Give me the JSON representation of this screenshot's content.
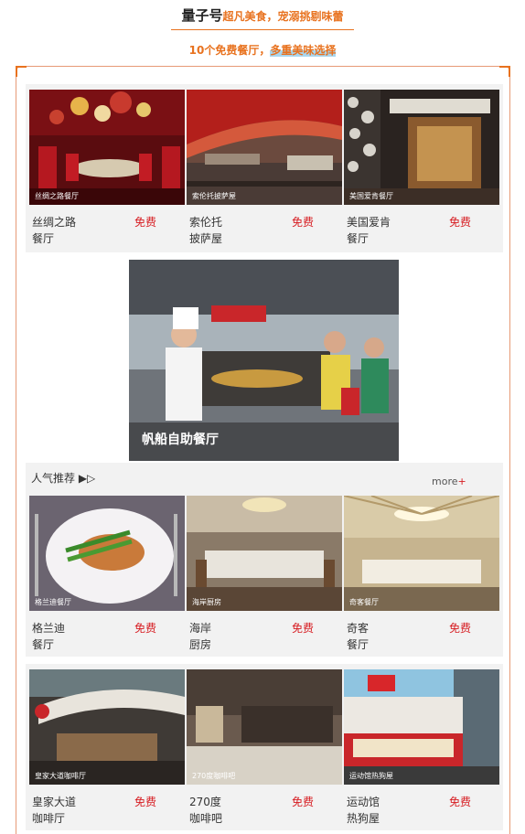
{
  "header": {
    "title_main": "量子号",
    "title_accent": "超凡美食，宠溺挑剔味蕾",
    "subtitle_part1": "10个免费餐厅，",
    "subtitle_part2": "多重美味选择"
  },
  "row1": [
    {
      "caption": "丝绸之路餐厅",
      "name_line1": "丝绸之路",
      "name_line2": "餐厅",
      "price": "免费"
    },
    {
      "caption": "索伦托披萨屋",
      "name_line1": "索伦托",
      "name_line2": "披萨屋",
      "price": "免费"
    },
    {
      "caption": "美国爱肯餐厅",
      "name_line1": "美国爱肯",
      "name_line2": "餐厅",
      "price": "免费"
    }
  ],
  "featured": {
    "caption": "帆船自助餐厅"
  },
  "recommend": {
    "label": "人气推荐 ▶▷",
    "more": "more",
    "more_plus": "+"
  },
  "row2": [
    {
      "caption": "格兰迪餐厅",
      "name_line1": "格兰迪",
      "name_line2": "餐厅",
      "price": "免费"
    },
    {
      "caption": "海岸厨房",
      "name_line1": "海岸",
      "name_line2": "厨房",
      "price": "免费"
    },
    {
      "caption": "奇客餐厅",
      "name_line1": "奇客",
      "name_line2": "餐厅",
      "price": "免费"
    }
  ],
  "row3": [
    {
      "caption": "皇家大道咖啡厅",
      "name_line1": "皇家大道",
      "name_line2": "咖啡厅",
      "price": "免费"
    },
    {
      "caption": "270度咖啡吧",
      "name_line1": "270度",
      "name_line2": "咖啡吧",
      "price": "免费"
    },
    {
      "caption": "运动馆热狗屋",
      "name_line1": "运动馆",
      "name_line2": "热狗屋",
      "price": "免费"
    }
  ],
  "colors": {
    "accent": "#e8721f",
    "price_red": "#d71d22",
    "panel_gray": "#f2f2f2"
  }
}
